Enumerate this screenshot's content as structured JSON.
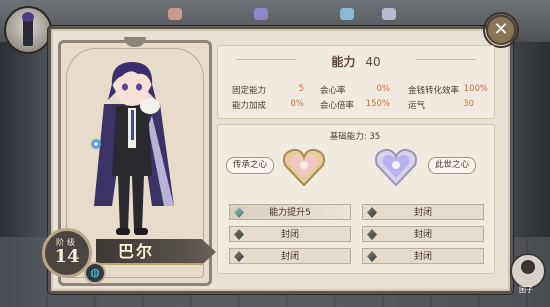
{
  "header": {
    "close_symbol": "✕"
  },
  "character": {
    "rank_label": "阶级",
    "level": "14",
    "name": "巴尔",
    "ring_icon": "ring-icon"
  },
  "stats": {
    "title": "能力",
    "total": "40",
    "rows": [
      {
        "label": "固定能力",
        "value": "5"
      },
      {
        "label": "会心率",
        "value": "0%"
      },
      {
        "label": "金钱转化效率",
        "value": "100%"
      },
      {
        "label": "能力加成",
        "value": "0%"
      },
      {
        "label": "会心倍率",
        "value": "150%"
      },
      {
        "label": "运气",
        "value": "30"
      }
    ]
  },
  "hearts": {
    "base_power_label": "基础能力: 35",
    "left_label": "传承之心",
    "right_label": "此世之心"
  },
  "slots": {
    "left": [
      "能力提升5",
      "封闭",
      "封闭"
    ],
    "right": [
      "封闭",
      "封闭",
      "封闭"
    ]
  },
  "corner_avatar": {
    "label": "困子"
  },
  "colors": {
    "accent_value": "#c0703b",
    "panel": "#e9e2d3",
    "frame": "#5b5650"
  }
}
